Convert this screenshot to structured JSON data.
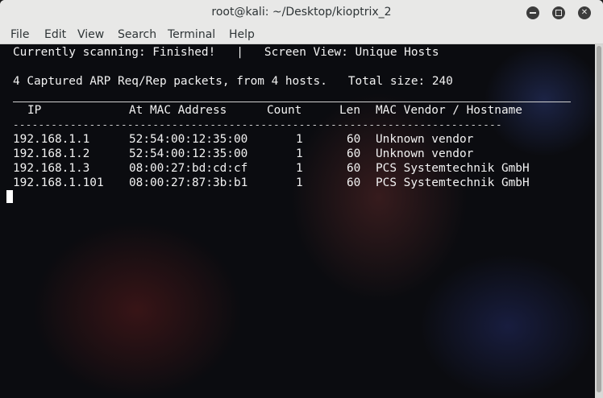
{
  "window": {
    "title": "root@kali: ~/Desktop/kioptrix_2",
    "minimize_icon": "minimize-icon",
    "maximize_icon": "maximize-icon",
    "close_icon": "close-icon"
  },
  "menu": {
    "items": [
      {
        "label": "File"
      },
      {
        "label": "Edit"
      },
      {
        "label": "View"
      },
      {
        "label": "Search"
      },
      {
        "label": "Terminal"
      },
      {
        "label": "Help"
      }
    ]
  },
  "terminal": {
    "status_line": "Currently scanning: Finished!   |   Screen View: Unique Hosts",
    "summary_line": "4 Captured ARP Req/Rep packets, from 4 hosts.   Total size: 240",
    "headers": {
      "ip": "IP",
      "mac": "At MAC Address",
      "count": "Count",
      "len": "Len",
      "vendor": "MAC Vendor / Hostname"
    },
    "dash_line": "-----------------------------------------------------------------------------",
    "rows": [
      {
        "ip": "192.168.1.1",
        "mac": "52:54:00:12:35:00",
        "count": "1",
        "len": "60",
        "vendor": "Unknown vendor"
      },
      {
        "ip": "192.168.1.2",
        "mac": "52:54:00:12:35:00",
        "count": "1",
        "len": "60",
        "vendor": "Unknown vendor"
      },
      {
        "ip": "192.168.1.3",
        "mac": "08:00:27:bd:cd:cf",
        "count": "1",
        "len": "60",
        "vendor": "PCS Systemtechnik GmbH"
      },
      {
        "ip": "192.168.1.101",
        "mac": "08:00:27:87:3b:b1",
        "count": "1",
        "len": "60",
        "vendor": "PCS Systemtechnik GmbH"
      }
    ]
  }
}
